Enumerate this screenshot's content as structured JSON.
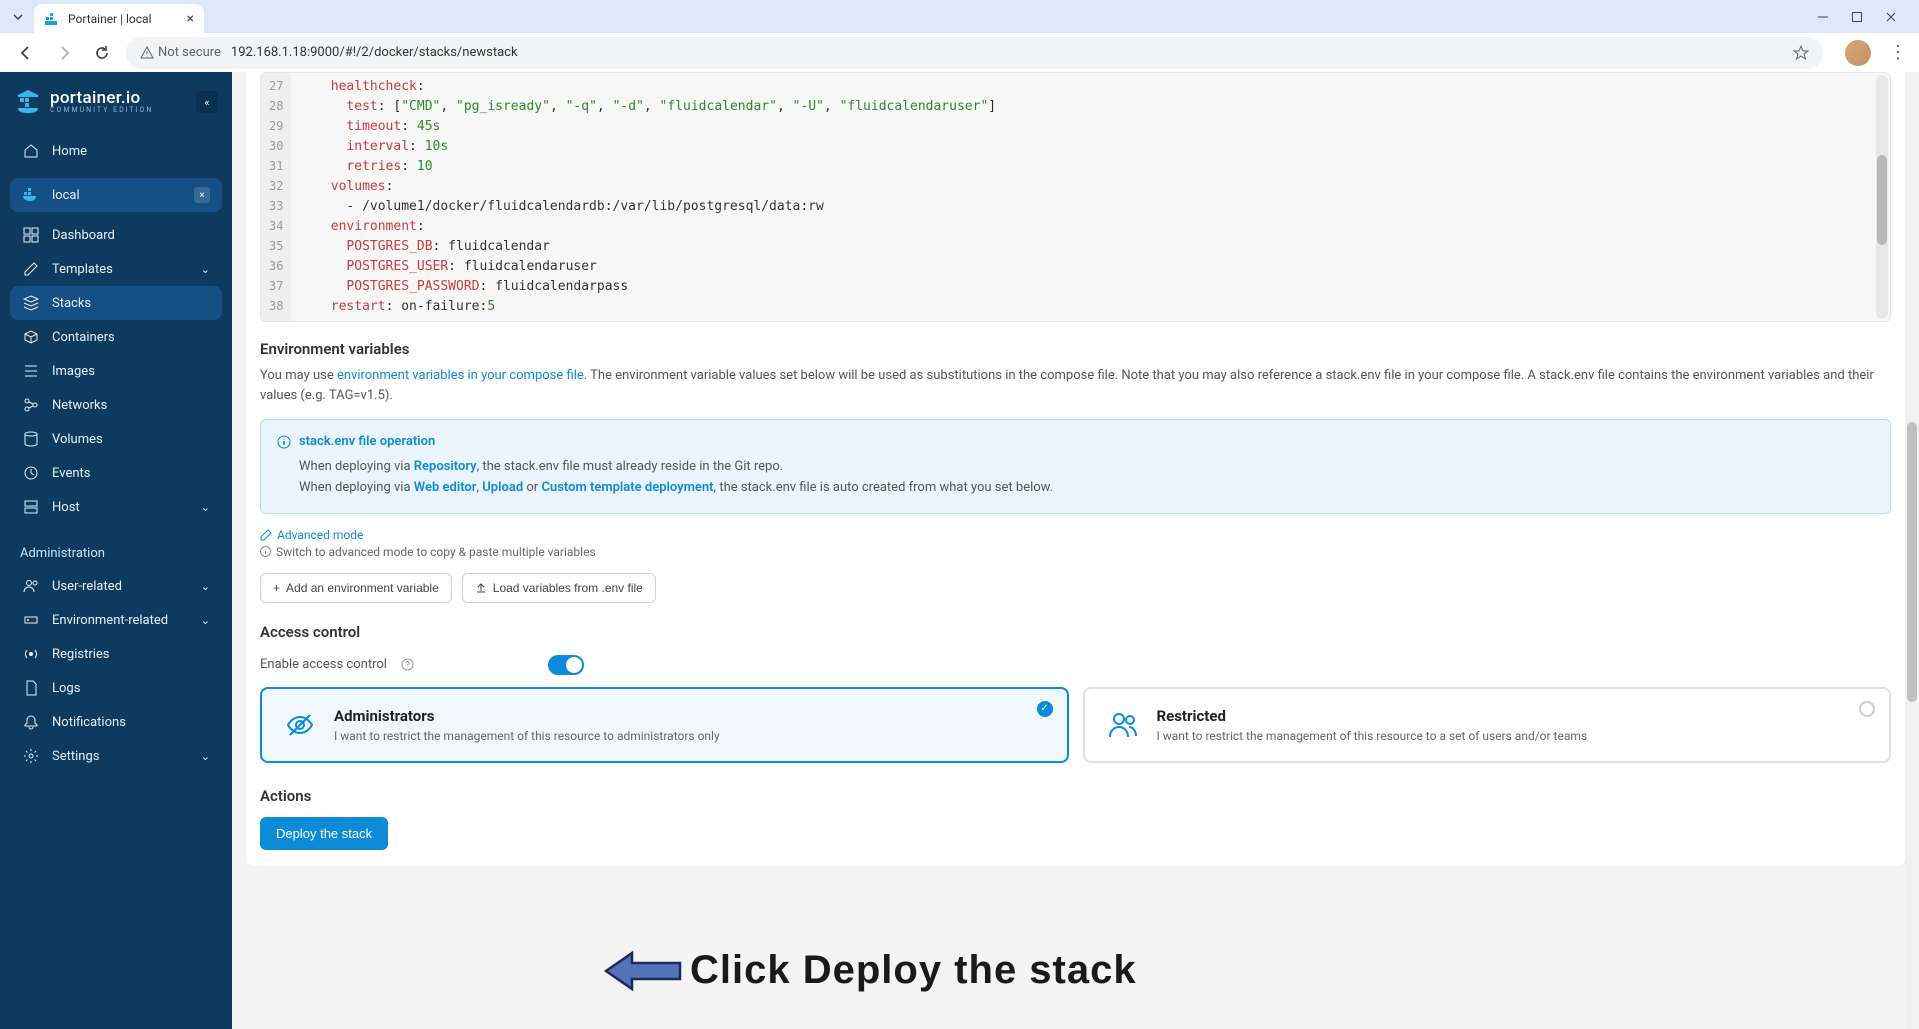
{
  "browser": {
    "tab_title": "Portainer | local",
    "security_label": "Not secure",
    "url": "192.168.1.18:9000/#!/2/docker/stacks/newstack"
  },
  "sidebar": {
    "logo_main": "portainer.io",
    "logo_sub": "COMMUNITY EDITION",
    "home": "Home",
    "env_name": "local",
    "items": [
      "Dashboard",
      "Templates",
      "Stacks",
      "Containers",
      "Images",
      "Networks",
      "Volumes",
      "Events",
      "Host"
    ],
    "admin_label": "Administration",
    "admin_items": [
      "User-related",
      "Environment-related",
      "Registries",
      "Logs",
      "Notifications",
      "Settings"
    ]
  },
  "editor": {
    "lines": [
      27,
      28,
      29,
      30,
      31,
      32,
      33,
      34,
      35,
      36,
      37,
      38
    ],
    "code": [
      {
        "indent": "    ",
        "key": "healthcheck",
        "rest": ":"
      },
      {
        "indent": "      ",
        "key": "test",
        "rest": ": [\"CMD\", \"pg_isready\", \"-q\", \"-d\", \"fluidcalendar\", \"-U\", \"fluidcalendaruser\"]"
      },
      {
        "indent": "      ",
        "key": "timeout",
        "rest": ": 45s"
      },
      {
        "indent": "      ",
        "key": "interval",
        "rest": ": 10s"
      },
      {
        "indent": "      ",
        "key": "retries",
        "rest": ": 10"
      },
      {
        "indent": "    ",
        "key": "volumes",
        "rest": ":"
      },
      {
        "indent": "      ",
        "key": "",
        "rest": "- /volume1/docker/fluidcalendardb:/var/lib/postgresql/data:rw"
      },
      {
        "indent": "    ",
        "key": "environment",
        "rest": ":"
      },
      {
        "indent": "      ",
        "key": "POSTGRES_DB",
        "rest": ": fluidcalendar"
      },
      {
        "indent": "      ",
        "key": "POSTGRES_USER",
        "rest": ": fluidcalendaruser"
      },
      {
        "indent": "      ",
        "key": "POSTGRES_PASSWORD",
        "rest": ": fluidcalendarpass"
      },
      {
        "indent": "    ",
        "key": "restart",
        "rest": ": on-failure:5"
      }
    ]
  },
  "env_section": {
    "heading": "Environment variables",
    "p_pre": "You may use ",
    "p_link": "environment variables in your compose file",
    "p_post": ". The environment variable values set below will be used as substitutions in the compose file. Note that you may also reference a stack.env file in your compose file. A stack.env file contains the environment variables and their values (e.g. TAG=v1.5).",
    "info_title": "stack.env file operation",
    "info_l1_pre": "When deploying via ",
    "info_l1_b": "Repository",
    "info_l1_post": ", the stack.env file must already reside in the Git repo.",
    "info_l2_pre": "When deploying via ",
    "info_l2_b1": "Web editor",
    "info_l2_mid1": ", ",
    "info_l2_b2": "Upload",
    "info_l2_mid2": " or ",
    "info_l2_b3": "Custom template deployment",
    "info_l2_post": ", the stack.env file is auto created from what you set below.",
    "advanced": "Advanced mode",
    "advanced_tip": "Switch to advanced mode to copy & paste multiple variables",
    "btn_add": "Add an environment variable",
    "btn_load": "Load variables from .env file"
  },
  "access": {
    "heading": "Access control",
    "enable_label": "Enable access control",
    "admin_title": "Administrators",
    "admin_desc": "I want to restrict the management of this resource to administrators only",
    "restr_title": "Restricted",
    "restr_desc": "I want to restrict the management of this resource to a set of users and/or teams"
  },
  "actions": {
    "heading": "Actions",
    "deploy": "Deploy the stack"
  },
  "annotation": "Click Deploy the stack"
}
